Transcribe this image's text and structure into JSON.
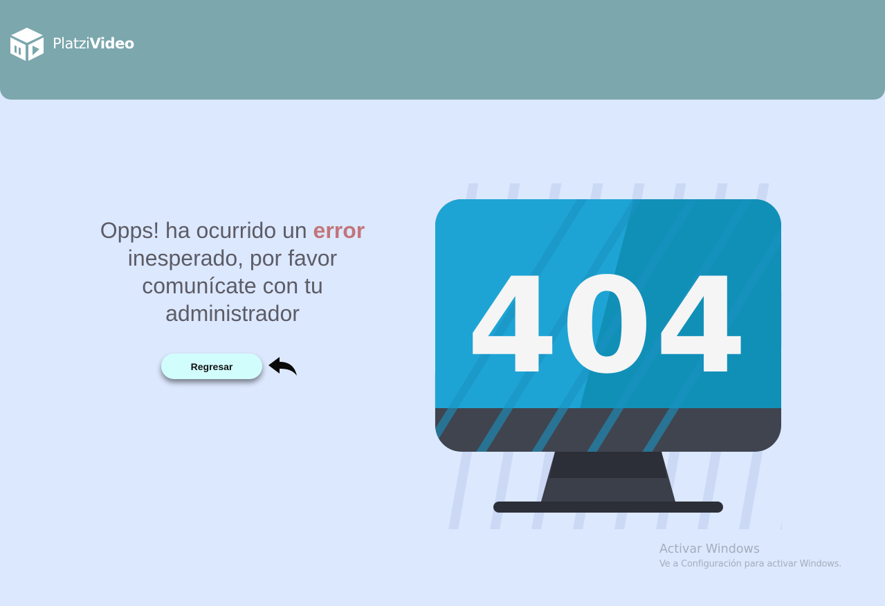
{
  "header": {
    "logo": {
      "text_light": "Platzi",
      "text_bold": "Video",
      "icon": "box-play-icon"
    },
    "background": "#7ba7ad"
  },
  "message": {
    "part1": "Opps! ha ocurrido un ",
    "highlight": "error",
    "part2": " inesperado, por favor comunícate con tu administrador",
    "highlight_color": "#c2757a"
  },
  "back_button": {
    "label": "Regresar",
    "icon": "back-arrow-icon"
  },
  "illustration": {
    "text": "404",
    "icon": "monitor-404-illustration",
    "screen_color": "#1ea4d4",
    "frame_color": "#40444f"
  },
  "watermark": {
    "title": "Activar Windows",
    "subtitle": "Ve a Configuración para activar Windows."
  }
}
